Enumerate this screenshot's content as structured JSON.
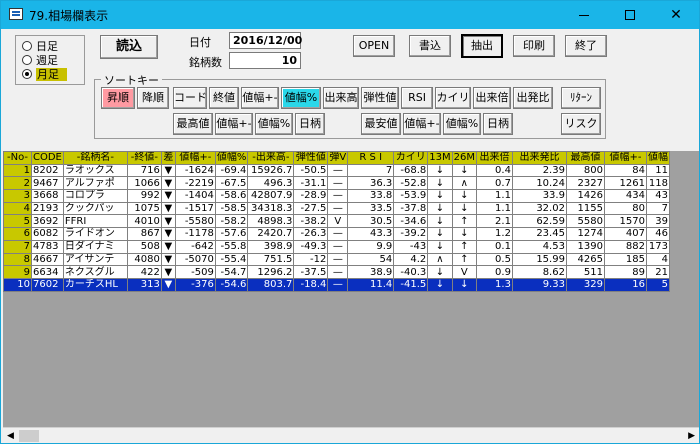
{
  "window": {
    "title": "79.相場欄表示",
    "min": "—",
    "close": "✕"
  },
  "period": {
    "items": [
      "日足",
      "週足",
      "月足"
    ],
    "selected": 2
  },
  "buttons": {
    "load": "読込",
    "open": "OPEN",
    "write": "書込",
    "extract": "抽出",
    "print": "印刷",
    "exit": "終了",
    "return": "ﾘﾀｰﾝ",
    "risk": "リスク"
  },
  "info": {
    "date_label": "日付",
    "date_value": "2016/12/00",
    "count_label": "銘柄数",
    "count_value": "10"
  },
  "sort": {
    "title": "ソートキー",
    "asc": "昇順",
    "desc": "降順",
    "row1": [
      "コード",
      "終値",
      "値幅+-",
      "値幅%",
      "出来高",
      "弾性値",
      "RSI",
      "カイリ",
      "出来倍",
      "出発比"
    ],
    "row2_left": [
      "最高値",
      "値幅+-",
      "値幅%",
      "日柄"
    ],
    "row2_right": [
      "最安値",
      "値幅+-",
      "値幅%",
      "日柄"
    ]
  },
  "table": {
    "headers": [
      "-No-",
      "CODE",
      "-銘柄名-",
      "-終値-",
      "差",
      "値幅+-",
      "値幅%",
      "-出来高-",
      "弾性値",
      "弾V",
      "R S I",
      "カイリ",
      "13M",
      "26M",
      "出来倍",
      "出来発比",
      "最高値",
      "値幅+-",
      "値幅"
    ],
    "rows": [
      [
        "1",
        "8202",
        "ラオックス",
        "716",
        "▼",
        "-1624",
        "-69.4",
        "15926.7",
        "-50.5",
        "—",
        "7",
        "-68.8",
        "↓",
        "↓",
        "0.4",
        "2.39",
        "800",
        "84",
        "11"
      ],
      [
        "2",
        "9467",
        "アルファポ",
        "1066",
        "▼",
        "-2219",
        "-67.5",
        "496.3",
        "-31.1",
        "—",
        "36.3",
        "-52.8",
        "↓",
        "∧",
        "0.7",
        "10.24",
        "2327",
        "1261",
        "118"
      ],
      [
        "3",
        "3668",
        "コロプラ",
        "992",
        "▼",
        "-1404",
        "-58.6",
        "42807.9",
        "-28.9",
        "—",
        "33.8",
        "-53.9",
        "↓",
        "↓",
        "1.1",
        "33.9",
        "1426",
        "434",
        "43"
      ],
      [
        "4",
        "2193",
        "クックパッ",
        "1075",
        "▼",
        "-1517",
        "-58.5",
        "34318.3",
        "-27.5",
        "—",
        "33.5",
        "-37.8",
        "↓",
        "↓",
        "1.1",
        "32.02",
        "1155",
        "80",
        "7"
      ],
      [
        "5",
        "3692",
        "FFRI",
        "4010",
        "▼",
        "-5580",
        "-58.2",
        "4898.3",
        "-38.2",
        "V",
        "30.5",
        "-34.6",
        "↓",
        "↑",
        "2.1",
        "62.59",
        "5580",
        "1570",
        "39"
      ],
      [
        "6",
        "6082",
        "ライドオン",
        "867",
        "▼",
        "-1178",
        "-57.6",
        "2420.7",
        "-26.3",
        "—",
        "43.3",
        "-39.2",
        "↓",
        "↓",
        "1.2",
        "23.45",
        "1274",
        "407",
        "46"
      ],
      [
        "7",
        "4783",
        "日ダイナミ",
        "508",
        "▼",
        "-642",
        "-55.8",
        "398.9",
        "-49.3",
        "—",
        "9.9",
        "-43",
        "↓",
        "↑",
        "0.1",
        "4.53",
        "1390",
        "882",
        "173"
      ],
      [
        "8",
        "4667",
        "アイサンテ",
        "4080",
        "▼",
        "-5070",
        "-55.4",
        "751.5",
        "-12",
        "—",
        "54",
        "4.2",
        "∧",
        "↑",
        "0.5",
        "15.99",
        "4265",
        "185",
        "4"
      ],
      [
        "9",
        "6634",
        "ネクスグル",
        "422",
        "▼",
        "-509",
        "-54.7",
        "1296.2",
        "-37.5",
        "—",
        "38.9",
        "-40.3",
        "↓",
        "V",
        "0.9",
        "8.62",
        "511",
        "89",
        "21"
      ],
      [
        "10",
        "7602",
        "カーチスHL",
        "313",
        "▼",
        "-376",
        "-54.6",
        "803.7",
        "-18.4",
        "—",
        "11.4",
        "-41.5",
        "↓",
        "↓",
        "1.3",
        "9.33",
        "329",
        "16",
        "5"
      ]
    ],
    "selected_row": 9
  },
  "colors": {
    "titlebar": "#1ab5e8",
    "header_bg": "#c8c800",
    "selected_row": "#0a2fbf",
    "asc_button": "#ff9aa2",
    "active_sort": "#2ad7e9"
  }
}
